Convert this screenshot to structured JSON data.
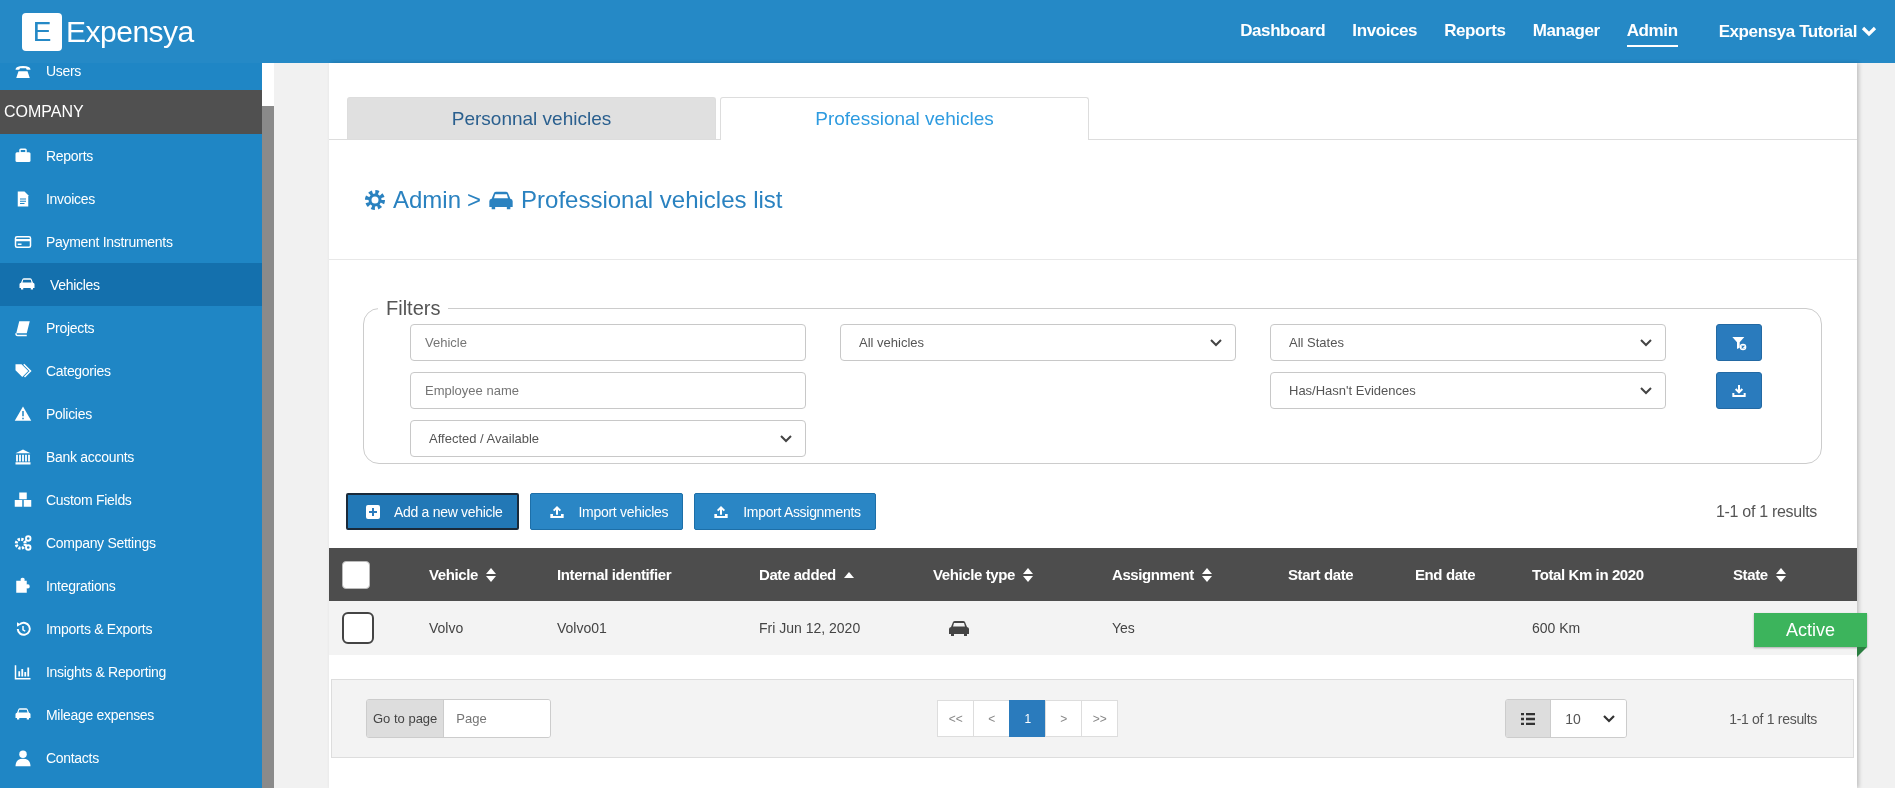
{
  "header": {
    "logo_mark": "E",
    "logo_text": "Expensya",
    "nav": [
      {
        "label": "Dashboard",
        "selected": false
      },
      {
        "label": "Invoices",
        "selected": false
      },
      {
        "label": "Reports",
        "selected": false
      },
      {
        "label": "Manager",
        "selected": false
      },
      {
        "label": "Admin",
        "selected": true
      }
    ],
    "user_menu": "Expensya Tutorial"
  },
  "sidebar": {
    "top_items": [
      {
        "label": "Users",
        "selected": false
      }
    ],
    "section": "COMPANY",
    "items": [
      {
        "label": "Reports",
        "selected": false
      },
      {
        "label": "Invoices",
        "selected": false
      },
      {
        "label": "Payment Instruments",
        "selected": false
      },
      {
        "label": "Vehicles",
        "selected": true
      },
      {
        "label": "Projects",
        "selected": false
      },
      {
        "label": "Categories",
        "selected": false
      },
      {
        "label": "Policies",
        "selected": false
      },
      {
        "label": "Bank accounts",
        "selected": false
      },
      {
        "label": "Custom Fields",
        "selected": false
      },
      {
        "label": "Company Settings",
        "selected": false
      },
      {
        "label": "Integrations",
        "selected": false
      },
      {
        "label": "Imports & Exports",
        "selected": false
      },
      {
        "label": "Insights & Reporting",
        "selected": false
      },
      {
        "label": "Mileage expenses",
        "selected": false
      },
      {
        "label": "Contacts",
        "selected": false
      }
    ]
  },
  "tabs": [
    {
      "label": "Personnal vehicles",
      "selected": false
    },
    {
      "label": "Professional vehicles",
      "selected": true
    }
  ],
  "breadcrumb": {
    "root": "Admin",
    "separator": ">",
    "page": "Professional vehicles list"
  },
  "filters": {
    "legend": "Filters",
    "columns": [
      [
        {
          "kind": "input",
          "placeholder": "Vehicle"
        },
        {
          "kind": "input",
          "placeholder": "Employee name"
        },
        {
          "kind": "select",
          "value": "Affected / Available"
        }
      ],
      [
        {
          "kind": "select",
          "value": "All vehicles"
        }
      ],
      [
        {
          "kind": "select",
          "value": "All States"
        },
        {
          "kind": "select",
          "value": "Has/Hasn't Evidences"
        }
      ]
    ]
  },
  "actions": [
    {
      "label": "Add a new vehicle",
      "kind": "add",
      "focused": true
    },
    {
      "label": "Import vehicles",
      "kind": "upload",
      "focused": false
    },
    {
      "label": "Import Assignments",
      "kind": "upload",
      "focused": false
    }
  ],
  "results_count": "1-1 of 1 results",
  "table": {
    "select_all_checked": false,
    "columns": [
      {
        "label": "Vehicle",
        "sortable": true
      },
      {
        "label": "Internal identifier",
        "sortable": false
      },
      {
        "label": "Date added",
        "sortable": true,
        "sorted": true
      },
      {
        "label": "Vehicle type",
        "sortable": true
      },
      {
        "label": "Assignment",
        "sortable": true
      },
      {
        "label": "Start date",
        "sortable": false
      },
      {
        "label": "End date",
        "sortable": false
      },
      {
        "label": "Total Km in 2020",
        "sortable": false
      },
      {
        "label": "State",
        "sortable": true
      }
    ],
    "rows": [
      {
        "checked": false,
        "vehicle": "Volvo",
        "internal_identifier": "Volvo01",
        "date_added": "Fri Jun 12, 2020",
        "assignment": "Yes",
        "total_km": "600 Km",
        "state": {
          "label": "Active",
          "color": "#3cb45c"
        }
      }
    ]
  },
  "pagination": {
    "go_to_label": "Go to page",
    "page_placeholder": "Page",
    "pages": [
      {
        "label": "<<",
        "selected": false
      },
      {
        "label": "<",
        "selected": false
      },
      {
        "label": "1",
        "selected": true
      },
      {
        "label": ">",
        "selected": false
      },
      {
        "label": ">>",
        "selected": false
      }
    ],
    "page_size": "10",
    "results": "1-1 of 1 results"
  }
}
